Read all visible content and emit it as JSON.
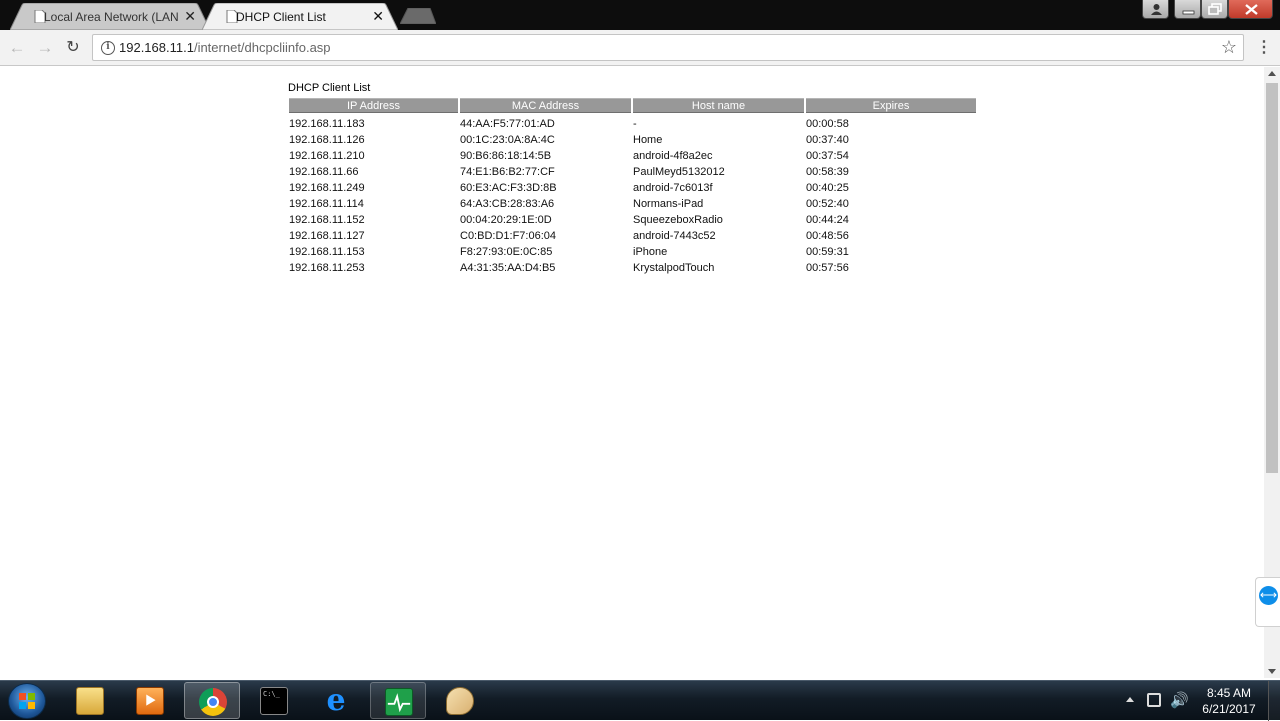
{
  "browser": {
    "tabs": [
      {
        "title": "Local Area Network (LAN"
      },
      {
        "title": "DHCP Client List"
      }
    ],
    "url_host": "192.168.11.1",
    "url_path": "/internet/dhcpcliinfo.asp"
  },
  "page": {
    "title": "DHCP Client List",
    "columns": [
      "IP Address",
      "MAC Address",
      "Host name",
      "Expires"
    ],
    "rows": [
      [
        "192.168.11.183",
        "44:AA:F5:77:01:AD",
        "-",
        "00:00:58"
      ],
      [
        "192.168.11.126",
        "00:1C:23:0A:8A:4C",
        "Home",
        "00:37:40"
      ],
      [
        "192.168.11.210",
        "90:B6:86:18:14:5B",
        "android-4f8a2ec",
        "00:37:54"
      ],
      [
        "192.168.11.66",
        "74:E1:B6:B2:77:CF",
        "PaulMeyd5132012",
        "00:58:39"
      ],
      [
        "192.168.11.249",
        "60:E3:AC:F3:3D:8B",
        "android-7c6013f",
        "00:40:25"
      ],
      [
        "192.168.11.114",
        "64:A3:CB:28:83:A6",
        "Normans-iPad",
        "00:52:40"
      ],
      [
        "192.168.11.152",
        "00:04:20:29:1E:0D",
        "SqueezeboxRadio",
        "00:44:24"
      ],
      [
        "192.168.11.127",
        "C0:BD:D1:F7:06:04",
        "android-7443c52",
        "00:48:56"
      ],
      [
        "192.168.11.153",
        "F8:27:93:0E:0C:85",
        "iPhone",
        "00:59:31"
      ],
      [
        "192.168.11.253",
        "A4:31:35:AA:D4:B5",
        "KrystalpodTouch",
        "00:57:56"
      ]
    ]
  },
  "taskbar": {
    "time": "8:45 AM",
    "date": "6/21/2017"
  },
  "icons": {
    "tab_close": "close-icon",
    "info": "info-icon",
    "star": "star-icon",
    "menu": "menu-icon"
  },
  "colors": {
    "table_header_bg": "#989898",
    "tab_strip_bg": "#0d0d0d",
    "taskbar_bg": "#121c26"
  }
}
